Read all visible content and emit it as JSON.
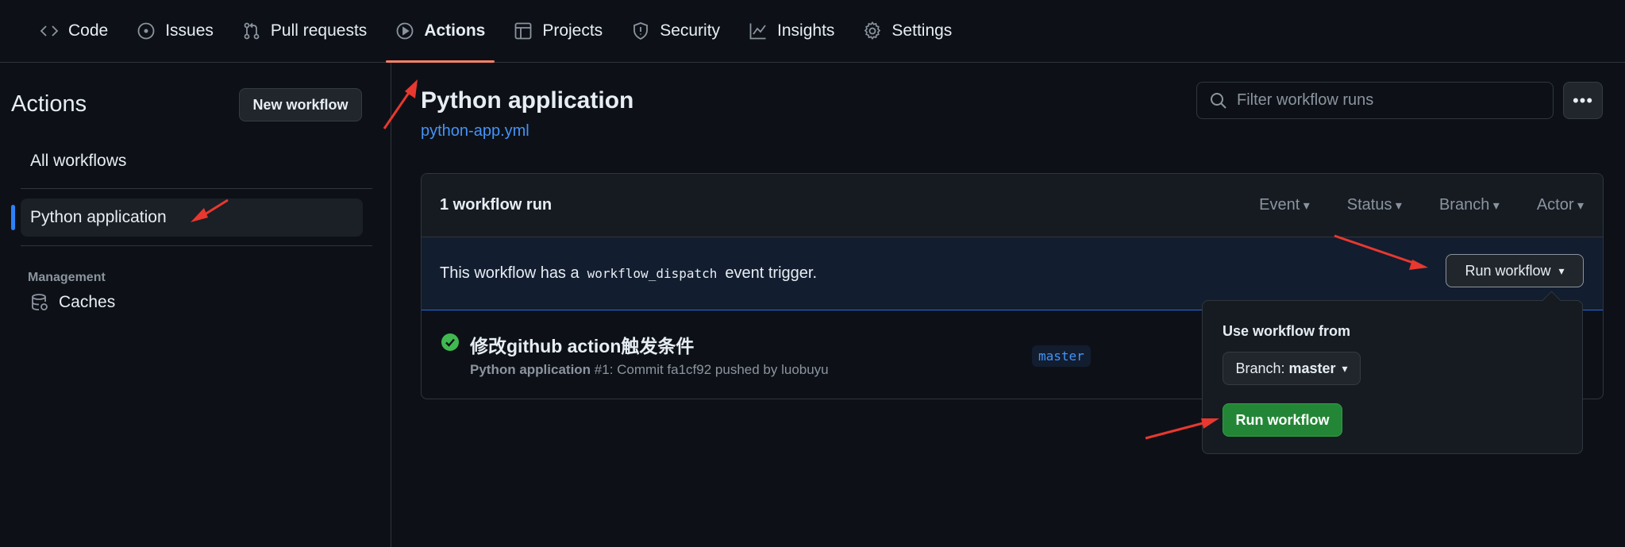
{
  "nav": {
    "tabs": [
      {
        "label": "Code",
        "icon": "code-icon"
      },
      {
        "label": "Issues",
        "icon": "issue-icon"
      },
      {
        "label": "Pull requests",
        "icon": "pull-request-icon"
      },
      {
        "label": "Actions",
        "icon": "play-icon",
        "active": true
      },
      {
        "label": "Projects",
        "icon": "table-icon"
      },
      {
        "label": "Security",
        "icon": "shield-icon"
      },
      {
        "label": "Insights",
        "icon": "graph-icon"
      },
      {
        "label": "Settings",
        "icon": "gear-icon"
      }
    ]
  },
  "sidebar": {
    "title": "Actions",
    "new_workflow": "New workflow",
    "all_workflows": "All workflows",
    "selected_workflow": "Python application",
    "management_heading": "Management",
    "caches": "Caches"
  },
  "main": {
    "title": "Python application",
    "file": "python-app.yml",
    "filter_placeholder": "Filter workflow runs",
    "more_label": "•••"
  },
  "runs": {
    "count_label": "1 workflow run",
    "filters": [
      "Event",
      "Status",
      "Branch",
      "Actor"
    ],
    "dispatch_prefix": "This workflow has a",
    "dispatch_code": "workflow_dispatch",
    "dispatch_suffix": "event trigger.",
    "run_workflow_button": "Run workflow",
    "items": [
      {
        "title": "修改github action触发条件",
        "workflow": "Python application",
        "detail": "#1: Commit fa1cf92 pushed by luobuyu",
        "branch": "master",
        "status": "success"
      }
    ]
  },
  "popover": {
    "label": "Use workflow from",
    "branch_prefix": "Branch:",
    "branch_value": "master",
    "submit": "Run workflow"
  },
  "colors": {
    "background": "#0d1117",
    "accent_tab": "#f78166",
    "link": "#4493f8",
    "success": "#3fb950",
    "primary_button": "#238636",
    "annotation_arrow": "#e8382f"
  }
}
